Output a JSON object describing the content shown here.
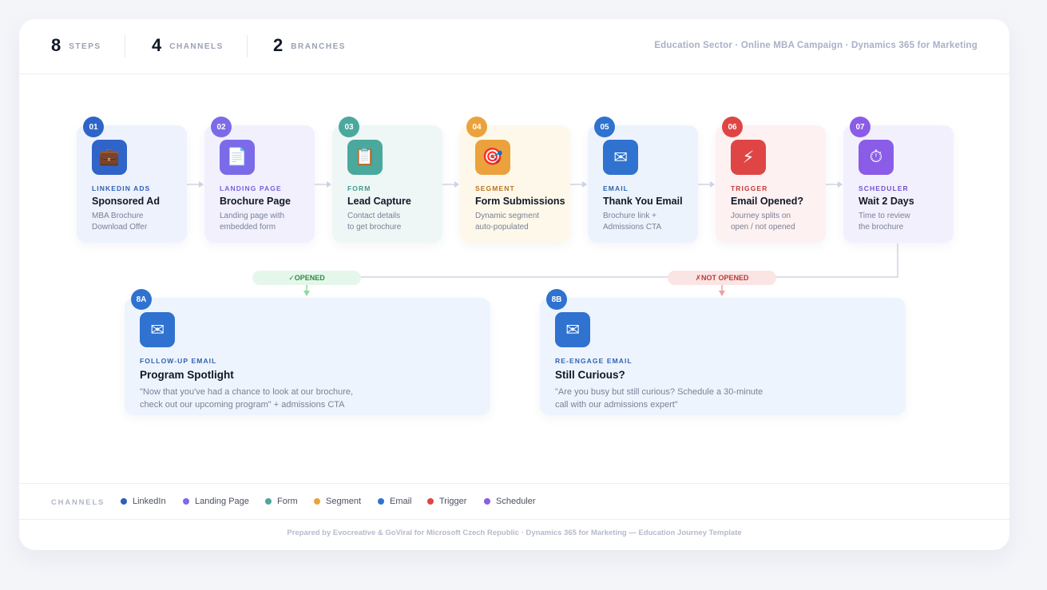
{
  "stats": [
    {
      "value": "8",
      "label": "STEPS"
    },
    {
      "value": "4",
      "label": "CHANNELS"
    },
    {
      "value": "2",
      "label": "BRANCHES"
    }
  ],
  "subtitle": "Education Sector · Online MBA Campaign · Dynamics 365 for Marketing",
  "steps": [
    {
      "num": "01",
      "category": "LINKEDIN ADS",
      "title": "Sponsored Ad",
      "desc1": "MBA Brochure",
      "desc2": "Download Offer",
      "icon": "briefcase-icon",
      "glyph": "💼",
      "color": "#2f64c8",
      "bg": "#edf2fc",
      "cat_color": "#2f5fb7"
    },
    {
      "num": "02",
      "category": "LANDING PAGE",
      "title": "Brochure Page",
      "desc1": "Landing page with",
      "desc2": "embedded form",
      "icon": "page-icon",
      "glyph": "📄",
      "color": "#7b6be8",
      "bg": "#f2f0fd",
      "cat_color": "#7264d6"
    },
    {
      "num": "03",
      "category": "FORM",
      "title": "Lead Capture",
      "desc1": "Contact details",
      "desc2": "to get brochure",
      "icon": "clipboard-icon",
      "glyph": "📋",
      "color": "#4aa89c",
      "bg": "#eef7f6",
      "cat_color": "#3f9a8e"
    },
    {
      "num": "04",
      "category": "SEGMENT",
      "title": "Form Submissions",
      "desc1": "Dynamic segment",
      "desc2": "auto-populated",
      "icon": "target-icon",
      "glyph": "🎯",
      "color": "#eba23c",
      "bg": "#fdf8ea",
      "cat_color": "#b8731c"
    },
    {
      "num": "05",
      "category": "EMAIL",
      "title": "Thank You Email",
      "desc1": "Brochure link +",
      "desc2": "Admissions CTA",
      "icon": "envelope-icon",
      "glyph": "✉",
      "color": "#2f72d0",
      "bg": "#edf3fc",
      "cat_color": "#2e63b2"
    },
    {
      "num": "06",
      "category": "TRIGGER",
      "title": "Email Opened?",
      "desc1": "Journey splits on",
      "desc2": "open / not opened",
      "icon": "lightning-icon",
      "glyph": "⚡",
      "color": "#e04545",
      "bg": "#fdf1f1",
      "cat_color": "#c53d3d"
    },
    {
      "num": "07",
      "category": "SCHEDULER",
      "title": "Wait 2 Days",
      "desc1": "Time to review",
      "desc2": "the brochure",
      "icon": "stopwatch-icon",
      "glyph": "⏱",
      "color": "#8a5ce8",
      "bg": "#f3f0fd",
      "cat_color": "#7350cf"
    }
  ],
  "branches": [
    {
      "num": "8A",
      "category": "FOLLOW-UP EMAIL",
      "title": "Program Spotlight",
      "desc1": "\"Now that you've had a chance to look at our brochure,",
      "desc2": "check out our upcoming program\" + admissions CTA",
      "icon": "envelope-icon",
      "glyph": "✉",
      "color": "#2f72d0"
    },
    {
      "num": "8B",
      "category": "RE-ENGAGE EMAIL",
      "title": "Still Curious?",
      "desc1": "\"Are you busy but still curious? Schedule a 30-minute",
      "desc2": "call with our admissions expert\"",
      "icon": "envelope-icon",
      "glyph": "✉",
      "color": "#2f72d0"
    }
  ],
  "pills": {
    "opened": "✓OPENED",
    "not_opened": "✗NOT OPENED"
  },
  "legend": {
    "title": "CHANNELS",
    "items": [
      {
        "label": "LinkedIn",
        "color": "#2f5fb7"
      },
      {
        "label": "Landing Page",
        "color": "#7b6be8"
      },
      {
        "label": "Form",
        "color": "#4aa89c"
      },
      {
        "label": "Segment",
        "color": "#eba23c"
      },
      {
        "label": "Email",
        "color": "#2f72d0"
      },
      {
        "label": "Trigger",
        "color": "#e04545"
      },
      {
        "label": "Scheduler",
        "color": "#8a5ce8"
      }
    ]
  },
  "footer": "Prepared by Evocreative & GoViral for Microsoft Czech Republic  ·  Dynamics 365 for Marketing — Education Journey Template"
}
